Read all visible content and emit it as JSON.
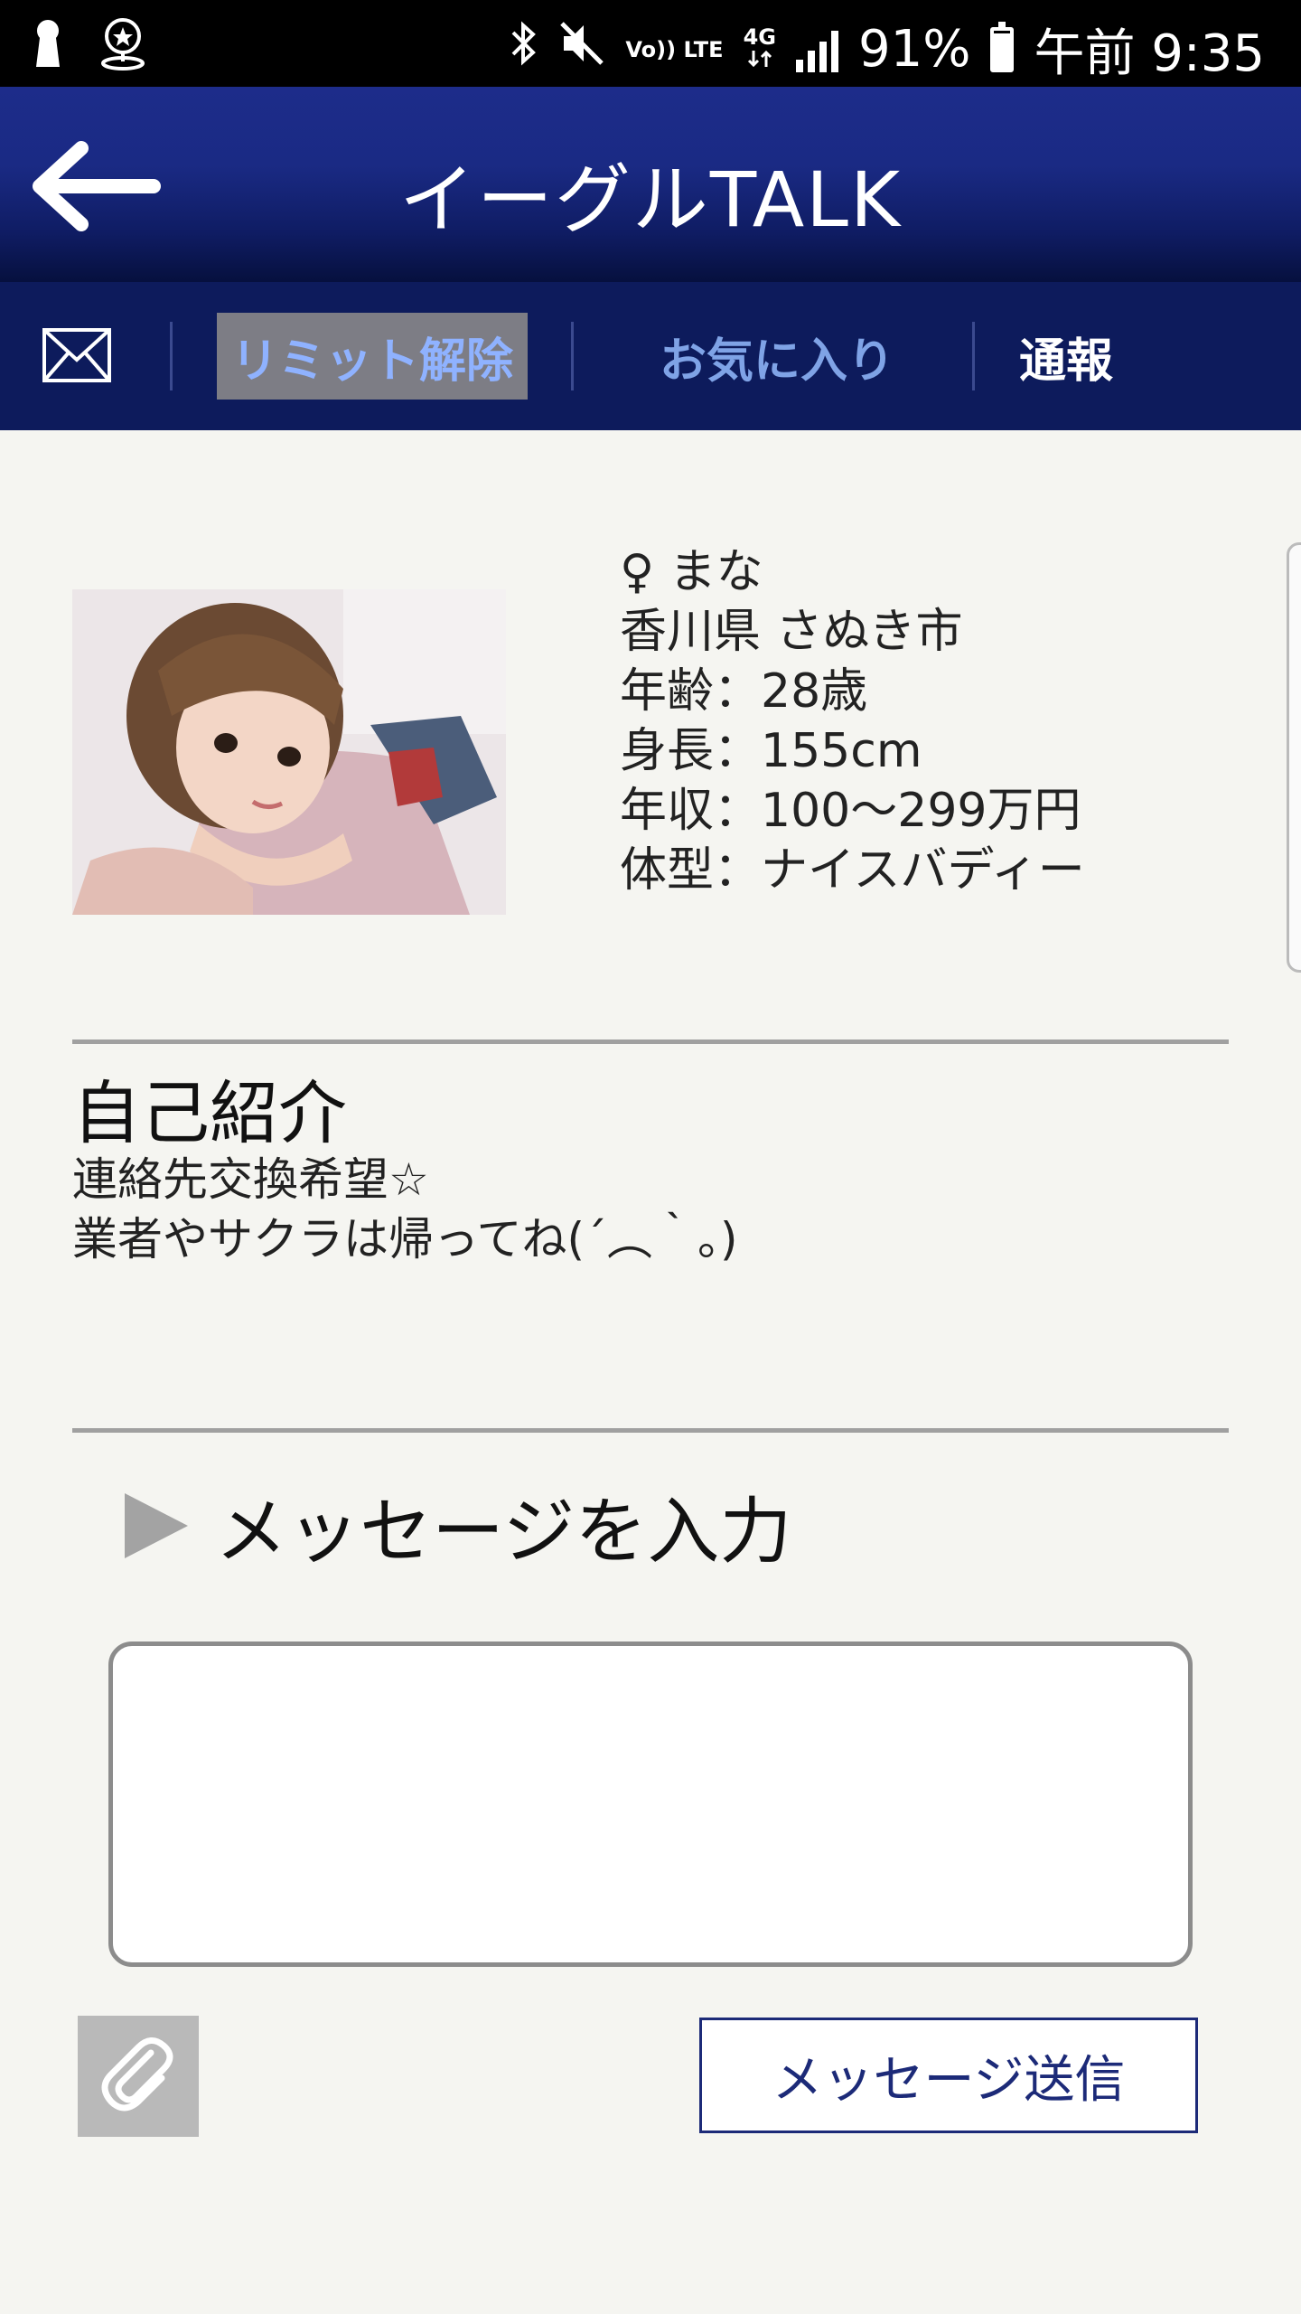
{
  "status_bar": {
    "battery_text": "91%",
    "time": "午前 9:35",
    "network_labels": [
      "Vo)) LTE",
      "4G"
    ],
    "battery_level": 0.91,
    "icons": [
      "keyhole-icon",
      "location-star-icon",
      "bluetooth-icon",
      "mute-icon",
      "volte-icon",
      "4g-icon",
      "signal-icon",
      "battery-icon"
    ]
  },
  "header": {
    "title": "イーグルTALK",
    "back_icon": "back-arrow-icon"
  },
  "nav": {
    "mail_icon": "mail-icon",
    "limit_label": "リミット解除",
    "favorite_label": "お気に入り",
    "report_label": "通報",
    "colors": {
      "bar": "#0d1b5c",
      "limit_bg": "#7d7d85",
      "limit_text": "#8fb2ff",
      "favorite_text": "#7fa3e6"
    }
  },
  "profile": {
    "name_line": "♀ まな",
    "location": "香川県 さぬき市",
    "age": "年齢：28歳",
    "height": "身長：155cm",
    "income": "年収：100～299万円",
    "body_type": "体型：ナイスバディー"
  },
  "intro": {
    "title": "自己紹介",
    "lines": [
      "連絡先交換希望☆",
      "業者やサクラは帰ってね(´︵｀。)"
    ]
  },
  "message": {
    "heading": "メッセージを入力",
    "input_value": "",
    "send_label": "メッセージ送信",
    "attach_icon": "paperclip-icon"
  }
}
